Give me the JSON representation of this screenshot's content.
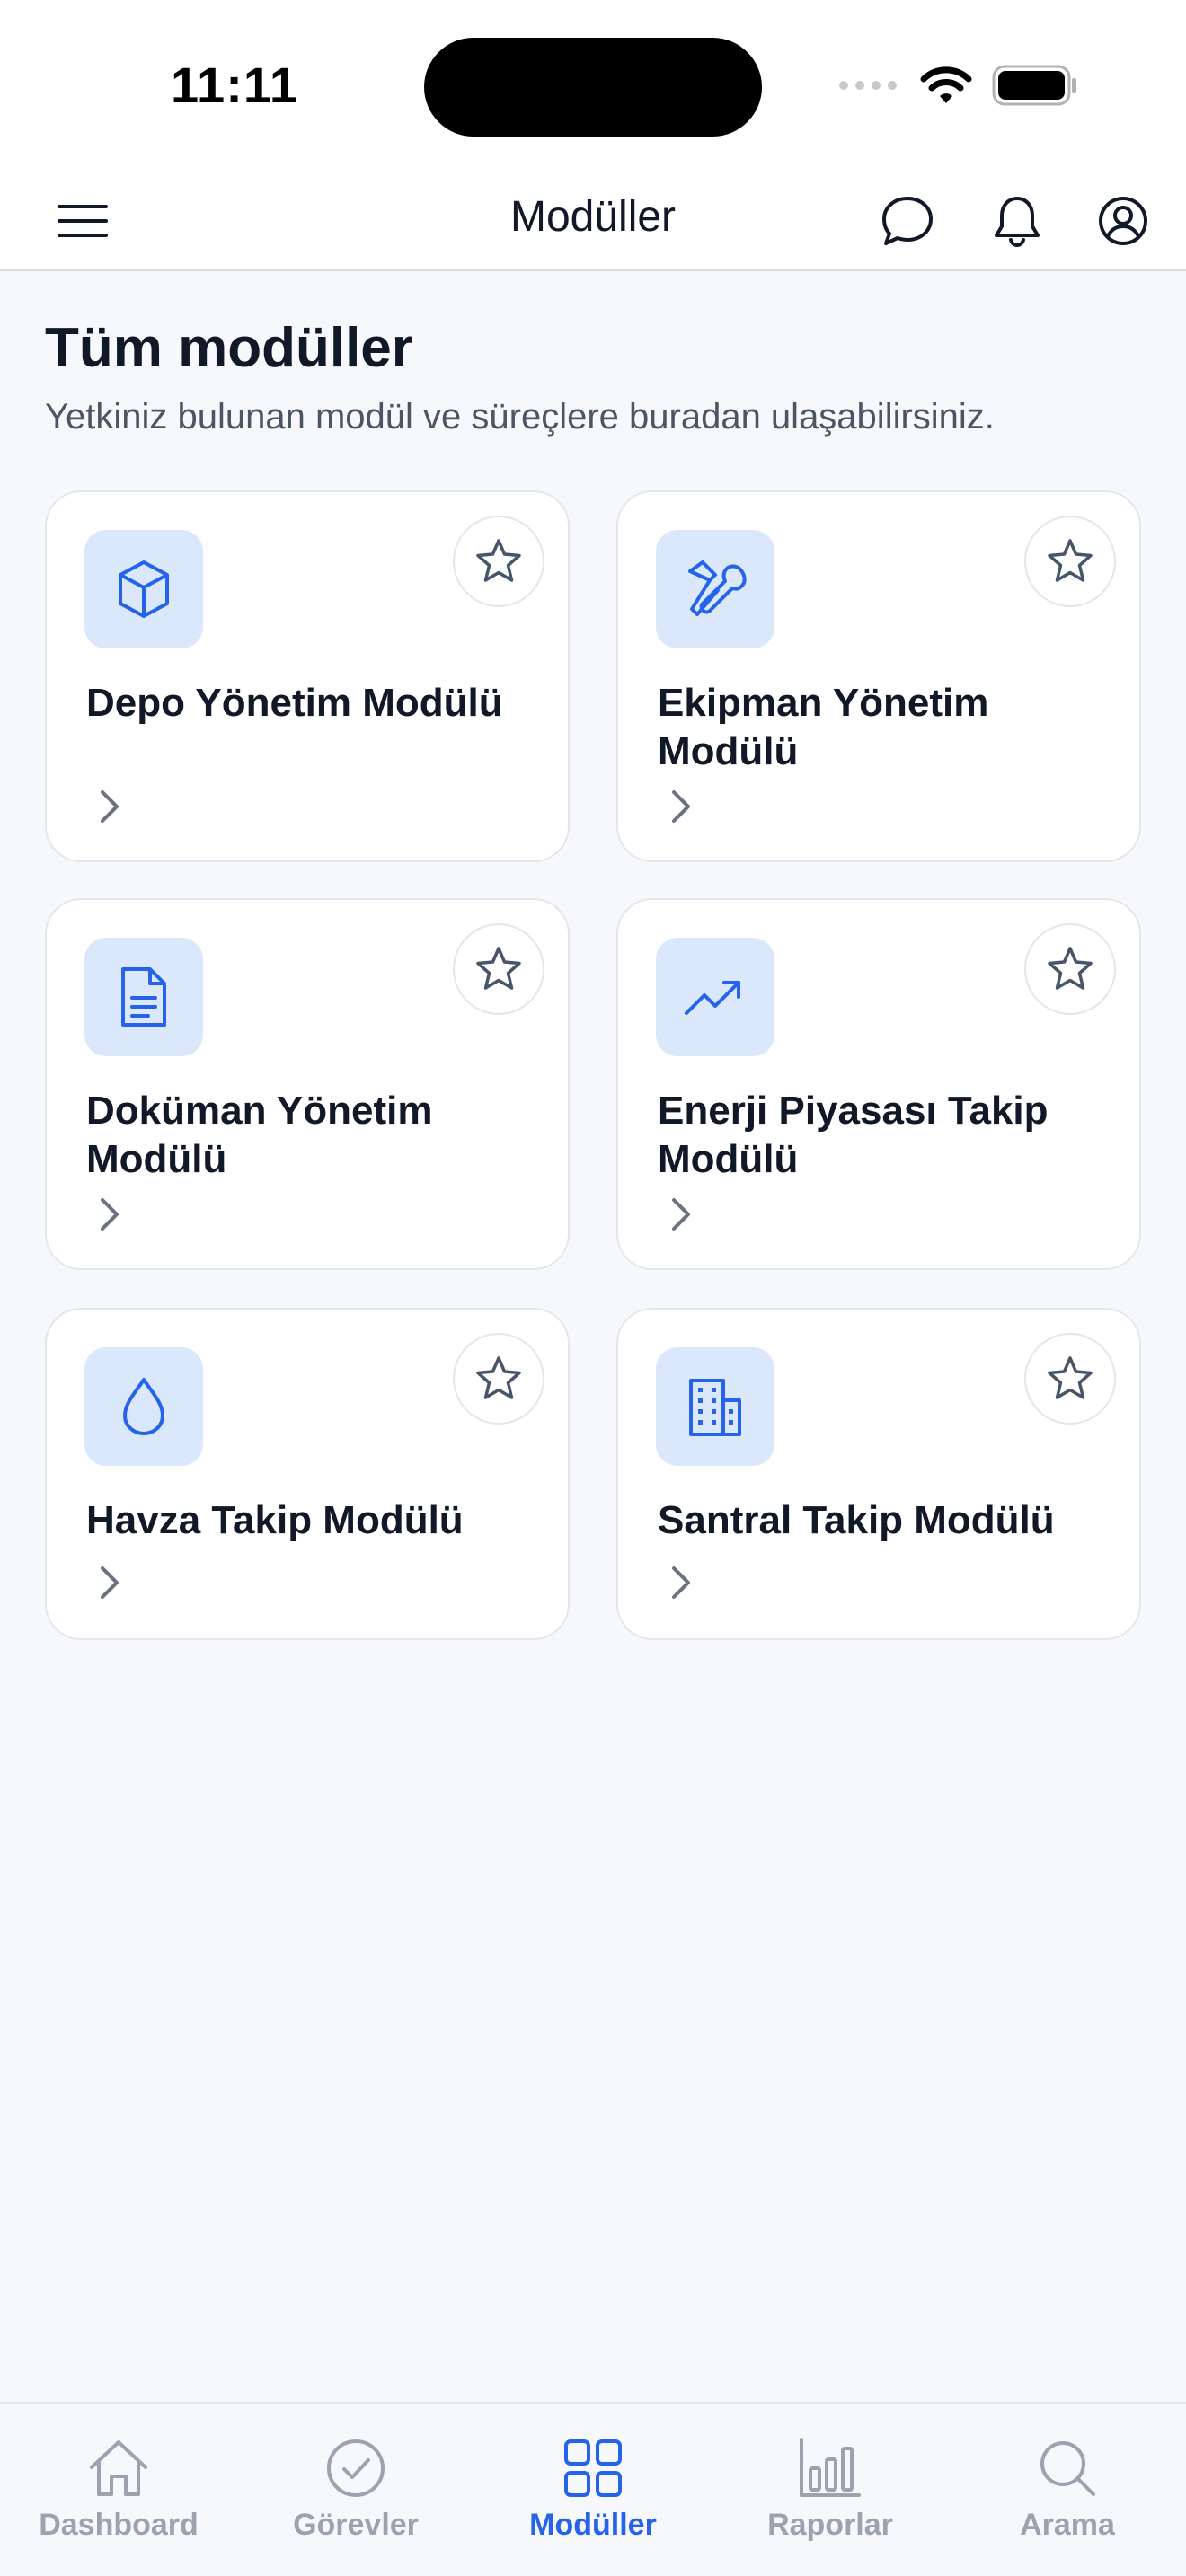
{
  "status_bar": {
    "time": "11:11"
  },
  "app_bar": {
    "title": "Modüller",
    "icons": [
      "menu-icon",
      "chat-icon",
      "bell-icon",
      "profile-icon"
    ]
  },
  "main": {
    "title": "Tüm modüller",
    "subtitle": "Yetkiniz bulunan modül ve süreçlere buradan ulaşabilirsiniz."
  },
  "modules": [
    {
      "title": "Depo Yönetim Modülü",
      "icon": "cube-icon"
    },
    {
      "title": "Ekipman Yönetim Modülü",
      "icon": "tools-icon"
    },
    {
      "title": "Doküman Yönetim Modülü",
      "icon": "document-icon"
    },
    {
      "title": "Enerji Piyasası Takip Modülü",
      "icon": "trend-up-icon"
    },
    {
      "title": "Havza Takip Modülü",
      "icon": "water-drop-icon"
    },
    {
      "title": "Santral Takip Modülü",
      "icon": "building-icon"
    }
  ],
  "bottom_nav": {
    "items": [
      {
        "label": "Dashboard",
        "icon": "home-icon"
      },
      {
        "label": "Görevler",
        "icon": "check-circle-icon"
      },
      {
        "label": "Modüller",
        "icon": "grid-icon"
      },
      {
        "label": "Raporlar",
        "icon": "bar-chart-icon"
      },
      {
        "label": "Arama",
        "icon": "search-icon"
      }
    ],
    "active": "Modüller"
  },
  "colors": {
    "accent": "#2563eb",
    "icon_bg": "#dbe8fb",
    "inactive": "#9ca3af",
    "text": "#111827",
    "subtext": "#4b5563",
    "background": "#f7f8fb"
  }
}
